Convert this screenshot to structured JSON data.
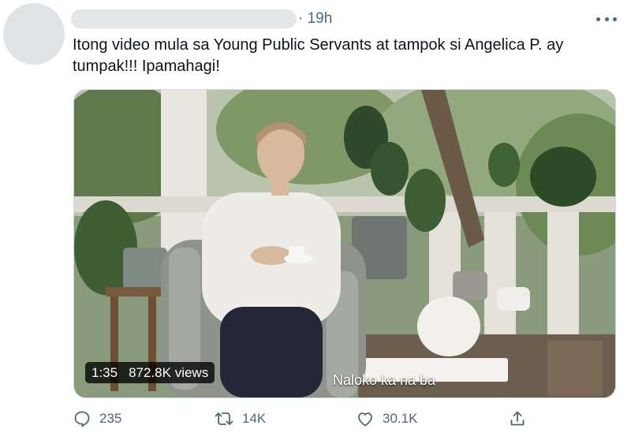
{
  "tweet": {
    "time": "· 19h",
    "text_line1": "Itong video mula sa Young Public Servants at tampok si Angelica P. ay",
    "text_line2": "tumpak!!! Ipamahagi!"
  },
  "video": {
    "duration": "1:35",
    "views": "872.8K views",
    "caption": "Naloko ka na ba"
  },
  "actions": {
    "replies": "235",
    "retweets": "14K",
    "likes": "30.1K"
  },
  "icons": [
    "more-icon",
    "reply-icon",
    "retweet-icon",
    "like-icon",
    "share-icon"
  ]
}
